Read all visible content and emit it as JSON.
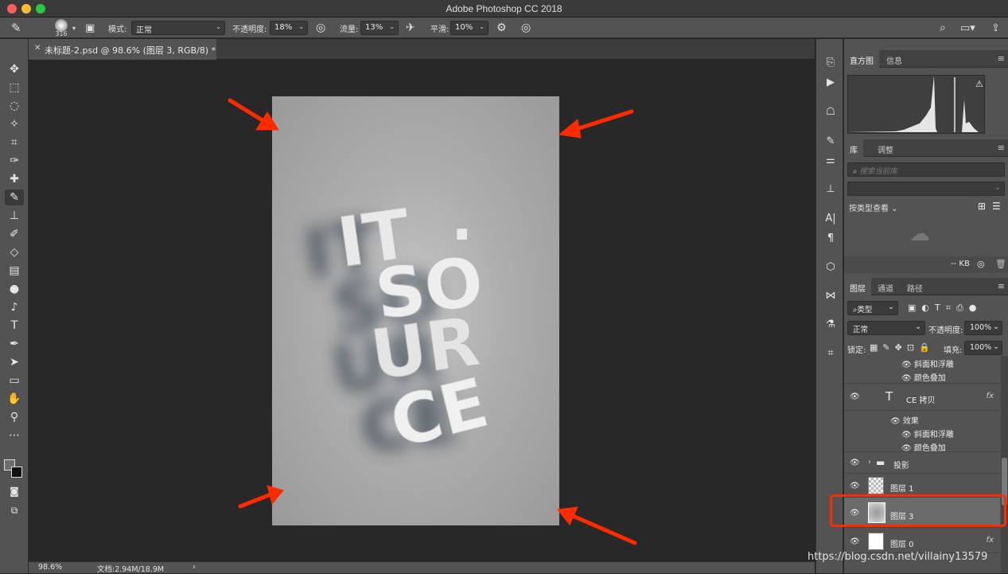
{
  "window": {
    "title": "Adobe Photoshop CC 2018"
  },
  "options": {
    "brush_size": "316",
    "mode_label": "模式:",
    "mode_value": "正常",
    "opacity_label": "不透明度:",
    "opacity_value": "18%",
    "flow_label": "流量:",
    "flow_value": "13%",
    "smooth_label": "平滑:",
    "smooth_value": "10%"
  },
  "document": {
    "tab_title": "未标题-2.psd @ 98.6% (图层 3, RGB/8) *",
    "artwork_text": [
      "IT",
      ".",
      "SO",
      "UR",
      "CE"
    ]
  },
  "status": {
    "zoom": "98.6%",
    "doc_size": "文档:2.94M/18.9M",
    "arrow": "›"
  },
  "panels": {
    "histogram": {
      "tabs": [
        "直方图",
        "信息"
      ]
    },
    "library": {
      "tabs": [
        "库",
        "调整"
      ],
      "search_placeholder": "搜索当前库",
      "view_label": "按类型查看",
      "size_label": "-- KB"
    },
    "layers": {
      "tabs": [
        "图层",
        "通道",
        "路径"
      ],
      "filter_label": "类型",
      "blend_mode": "正常",
      "opacity_label": "不透明度:",
      "opacity_value": "100%",
      "lock_label": "锁定:",
      "fill_label": "填充:",
      "fill_value": "100%",
      "effects_top": [
        "斜面和浮雕",
        "颜色叠加"
      ],
      "text_layer": {
        "name": "CE 拷贝",
        "type_glyph": "T",
        "fx": "fx"
      },
      "effects_label": "效果",
      "effects_bottom": [
        "斜面和浮雕",
        "颜色叠加"
      ],
      "group_layer": "投影",
      "layer1": "图层 1",
      "layer3": "图层 3",
      "layer0": "图层 0",
      "layer0_fx": "fx"
    }
  },
  "watermark": "https://blog.csdn.net/villainy13579",
  "colors": {
    "annotation_red": "#ff2a00",
    "panel_bg": "#535353",
    "canvas_bg": "#282828"
  }
}
